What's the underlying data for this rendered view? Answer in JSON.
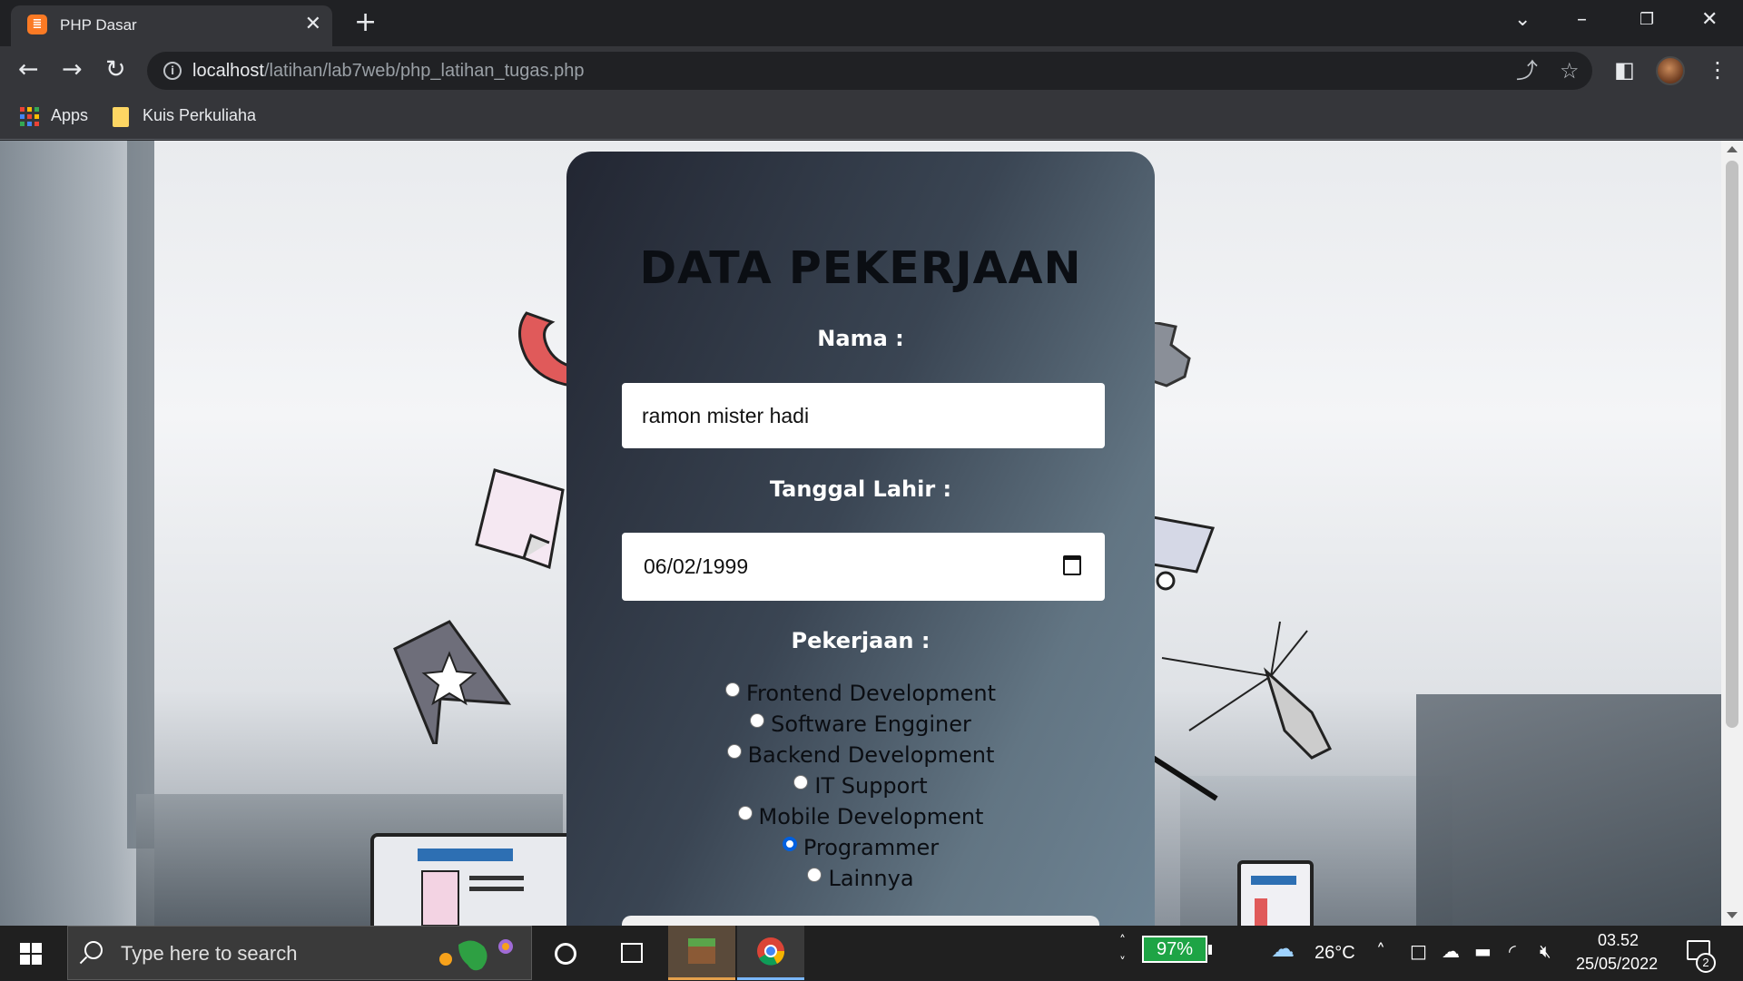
{
  "browser": {
    "tab_title": "PHP Dasar",
    "tab_favicon": "xampp-icon",
    "url_host": "localhost",
    "url_path": "/latihan/lab7web/php_latihan_tugas.php",
    "bookmarks": [
      {
        "label": "Apps",
        "icon": "apps-grid-icon"
      },
      {
        "label": "Kuis Perkuliaha",
        "icon": "folder-icon"
      }
    ]
  },
  "form": {
    "title": "DATA PEKERJAAN",
    "nama_label": "Nama :",
    "nama_value": "ramon mister hadi",
    "tanggal_label": "Tanggal Lahir :",
    "tanggal_value": "06/02/1999",
    "pekerjaan_label": "Pekerjaan :",
    "pekerjaan_options": [
      "Frontend Development",
      "Software Engginer",
      "Backend Development",
      "IT Support",
      "Mobile Development",
      "Programmer",
      "Lainnya"
    ],
    "pekerjaan_selected": "Programmer"
  },
  "taskbar": {
    "search_placeholder": "Type here to search",
    "battery": "97%",
    "temperature": "26°C",
    "time": "03.52",
    "date": "25/05/2022",
    "notification_count": "2"
  },
  "colors": {
    "selected_radio": "#0060df",
    "battery_fill": "#1ea445",
    "tab_favicon": "#fb7a24"
  }
}
